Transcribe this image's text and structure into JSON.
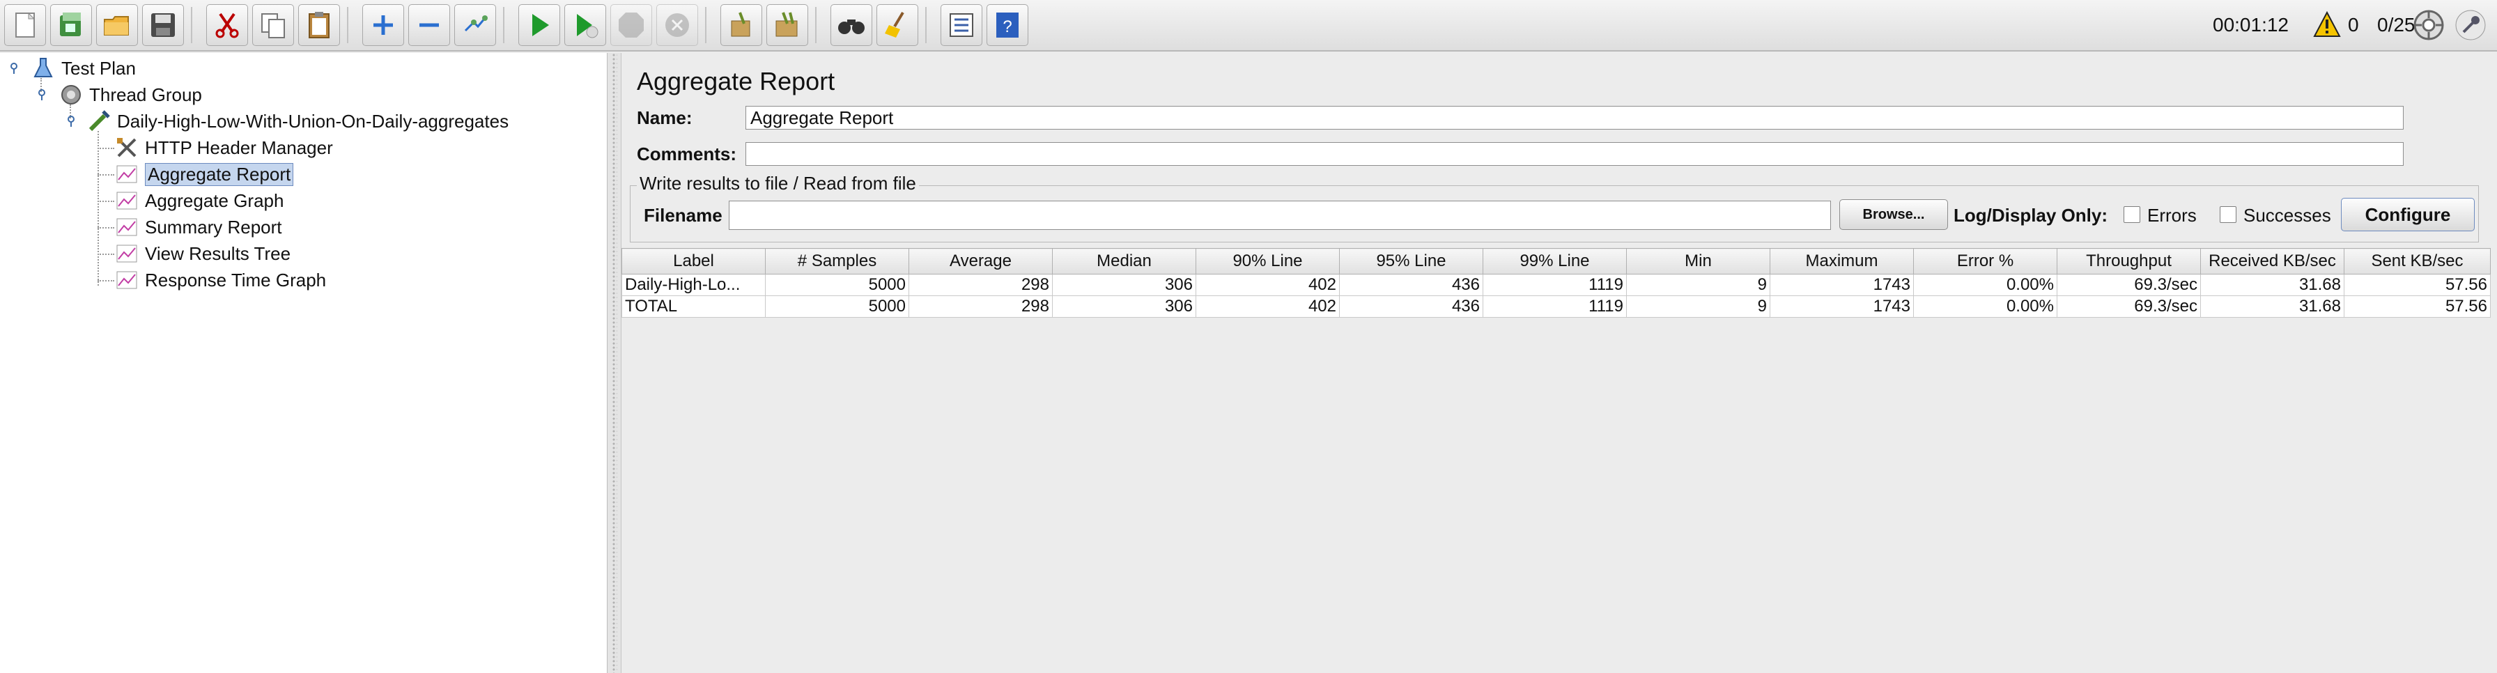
{
  "toolbar": {
    "buttons": [
      "new-icon",
      "templates-icon",
      "open-icon",
      "save-icon",
      "cut-icon",
      "copy-icon",
      "paste-icon",
      "expand-icon",
      "collapse-icon",
      "toggle-icon",
      "start-icon",
      "start-no-pauses-icon",
      "stop-icon",
      "shutdown-icon",
      "clear-icon",
      "clear-all-icon",
      "search-icon",
      "reset-search-icon",
      "function-helper-icon",
      "help-icon"
    ]
  },
  "status": {
    "elapsed": "00:01:12",
    "warnings": "0",
    "threads": "0/25"
  },
  "tree": {
    "items": [
      {
        "label": "Test Plan",
        "icon": "test-plan-icon"
      },
      {
        "label": "Thread Group",
        "icon": "thread-group-icon"
      },
      {
        "label": "Daily-High-Low-With-Union-On-Daily-aggregates",
        "icon": "sampler-icon"
      },
      {
        "label": "HTTP Header Manager",
        "icon": "config-icon"
      },
      {
        "label": "Aggregate Report",
        "icon": "listener-icon",
        "selected": true
      },
      {
        "label": "Aggregate Graph",
        "icon": "listener-icon"
      },
      {
        "label": "Summary Report",
        "icon": "listener-icon"
      },
      {
        "label": "View Results Tree",
        "icon": "listener-icon"
      },
      {
        "label": "Response Time Graph",
        "icon": "listener-icon"
      }
    ]
  },
  "panel": {
    "title": "Aggregate Report",
    "name_label": "Name:",
    "name_value": "Aggregate Report",
    "comments_label": "Comments:",
    "comments_value": "",
    "file_group_title": "Write results to file / Read from file",
    "filename_label": "Filename",
    "filename_value": "",
    "browse_label": "Browse...",
    "log_display_label": "Log/Display Only:",
    "errors_label": "Errors",
    "successes_label": "Successes",
    "configure_label": "Configure"
  },
  "table": {
    "columns": [
      "Label",
      "# Samples",
      "Average",
      "Median",
      "90% Line",
      "95% Line",
      "99% Line",
      "Min",
      "Maximum",
      "Error %",
      "Throughput",
      "Received KB/sec",
      "Sent KB/sec"
    ],
    "rows": [
      [
        "Daily-High-Lo...",
        "5000",
        "298",
        "306",
        "402",
        "436",
        "1119",
        "9",
        "1743",
        "0.00%",
        "69.3/sec",
        "31.68",
        "57.56"
      ],
      [
        "TOTAL",
        "5000",
        "298",
        "306",
        "402",
        "436",
        "1119",
        "9",
        "1743",
        "0.00%",
        "69.3/sec",
        "31.68",
        "57.56"
      ]
    ]
  }
}
